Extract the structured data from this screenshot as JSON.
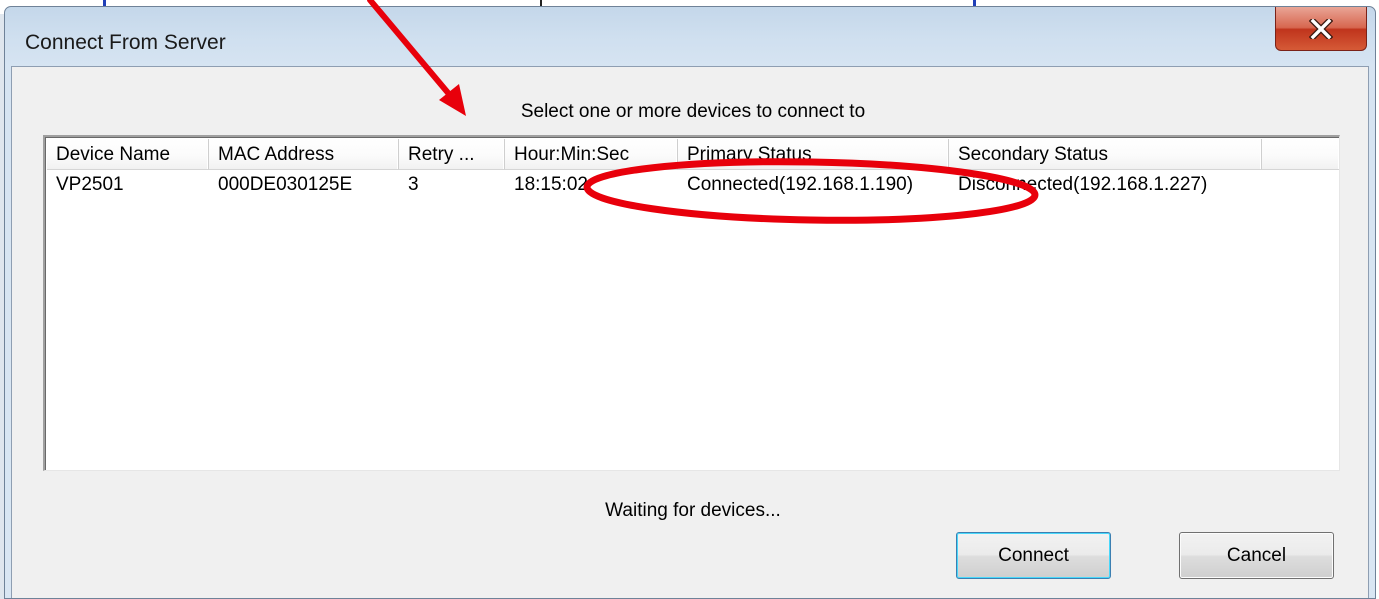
{
  "dialog": {
    "title": "Connect From Server",
    "close_glyph": "X",
    "instruction": "Select one or more devices to connect to",
    "status": "Waiting for devices...",
    "buttons": {
      "connect": "Connect",
      "cancel": "Cancel"
    }
  },
  "table": {
    "columns": [
      "Device Name",
      "MAC Address",
      "Retry ...",
      "Hour:Min:Sec",
      "Primary Status",
      "Secondary Status"
    ],
    "rows": [
      {
        "device_name": "VP2501",
        "mac_address": "000DE030125E",
        "retry": "3",
        "time": "18:15:02",
        "primary_status": "Connected(192.168.1.190)",
        "secondary_status": "Disconnected(192.168.1.227)"
      }
    ]
  },
  "annotation": {
    "color": "#e8000b",
    "arrow": "red-arrow",
    "highlight": "red-ellipse"
  },
  "colors": {
    "titlebar": "#c4d7ea",
    "client": "#f0f0f0",
    "close_button": "#c0341c"
  }
}
